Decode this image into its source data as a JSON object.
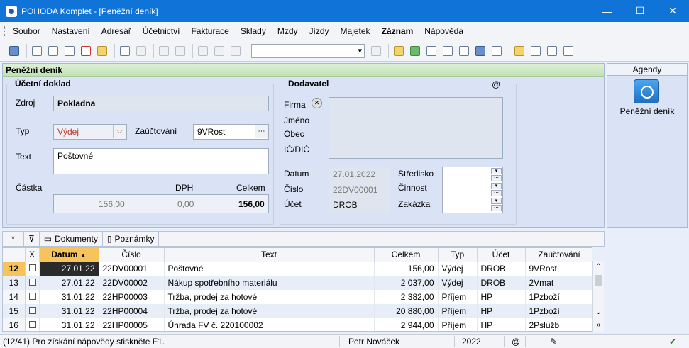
{
  "window": {
    "title": "POHODA Komplet - [Peněžní deník]"
  },
  "menu": [
    "Soubor",
    "Nastavení",
    "Adresář",
    "Účetnictví",
    "Fakturace",
    "Sklady",
    "Mzdy",
    "Jízdy",
    "Majetek",
    "Záznam",
    "Nápověda"
  ],
  "menu_bold_index": 9,
  "section_title": "Peněžní deník",
  "doc": {
    "group_title": "Účetní doklad",
    "zdroj_label": "Zdroj",
    "zdroj_value": "Pokladna",
    "typ_label": "Typ",
    "typ_value": "Výdej",
    "zauctovani_label": "Zaúčtování",
    "zauctovani_value": "9VRost",
    "text_label": "Text",
    "text_value": "Poštovné",
    "castka_label": "Částka",
    "dph_label": "DPH",
    "celkem_label": "Celkem",
    "castka_value": "156,00",
    "dph_value": "0,00",
    "celkem_value": "156,00"
  },
  "supplier": {
    "group_title": "Dodavatel",
    "at_symbol": "@",
    "firma_label": "Firma",
    "jmeno_label": "Jméno",
    "obec_label": "Obec",
    "ic_label": "IČ/DIČ",
    "datum_label": "Datum",
    "datum_value": "27.01.2022",
    "cislo_label": "Číslo",
    "cislo_value": "22DV00001",
    "ucet_label": "Účet",
    "ucet_value": "DROB",
    "stredisko_label": "Středisko",
    "cinnost_label": "Činnost",
    "zakazka_label": "Zakázka"
  },
  "agendy": {
    "title": "Agendy",
    "item_label": "Peněžní deník"
  },
  "tabs": {
    "star": "*",
    "dokumenty": "Dokumenty",
    "poznamky": "Poznámky"
  },
  "table": {
    "columns": [
      "X",
      "Datum",
      "Číslo",
      "Text",
      "Celkem",
      "Typ",
      "Účet",
      "Zaúčtování"
    ],
    "rows": [
      {
        "n": "12",
        "date": "27.01.22",
        "cislo": "22DV00001",
        "text": "Poštovné",
        "celkem": "156,00",
        "typ": "Výdej",
        "ucet": "DROB",
        "zauct": "9VRost"
      },
      {
        "n": "13",
        "date": "27.01.22",
        "cislo": "22DV00002",
        "text": "Nákup spotřebního materiálu",
        "celkem": "2 037,00",
        "typ": "Výdej",
        "ucet": "DROB",
        "zauct": "2Vmat"
      },
      {
        "n": "14",
        "date": "31.01.22",
        "cislo": "22HP00003",
        "text": "Tržba, prodej za hotové",
        "celkem": "2 382,00",
        "typ": "Příjem",
        "ucet": "HP",
        "zauct": "1Pzboží"
      },
      {
        "n": "15",
        "date": "31.01.22",
        "cislo": "22HP00004",
        "text": "Tržba, prodej za hotové",
        "celkem": "20 880,00",
        "typ": "Příjem",
        "ucet": "HP",
        "zauct": "1Pzboží"
      },
      {
        "n": "16",
        "date": "31.01.22",
        "cislo": "22HP00005",
        "text": "Úhrada FV č. 220100002",
        "celkem": "2 944,00",
        "typ": "Příjem",
        "ucet": "HP",
        "zauct": "2Pslužb"
      }
    ]
  },
  "status": {
    "help": "(12/41) Pro získání nápovědy stiskněte F1.",
    "user": "Petr Nováček",
    "year": "2022",
    "at": "@"
  }
}
